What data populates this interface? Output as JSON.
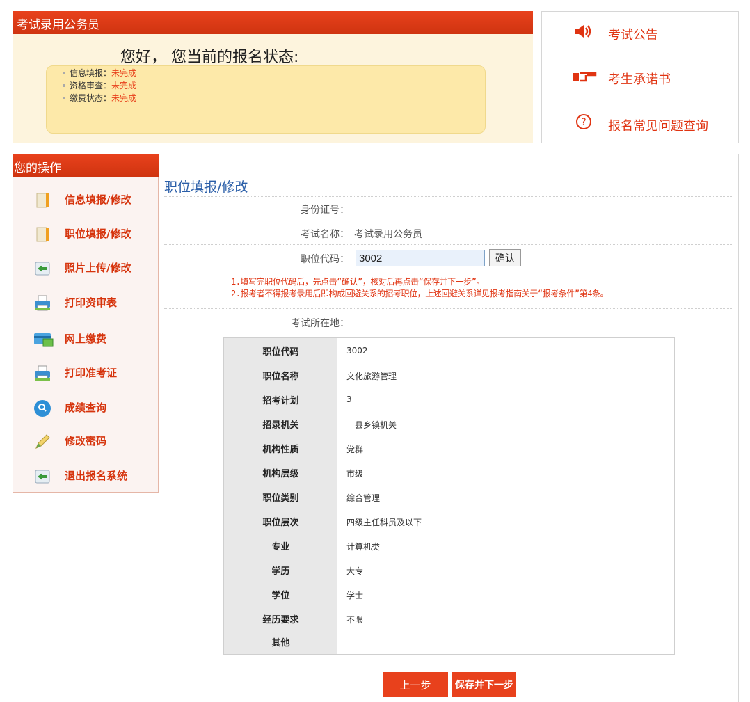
{
  "status": {
    "title": "考试录用公务员",
    "greeting": "您好， 您当前的报名状态:",
    "items": [
      {
        "label": "信息填报：",
        "value": "未完成"
      },
      {
        "label": "资格审查：",
        "value": "未完成"
      },
      {
        "label": "缴费状态：",
        "value": "未完成"
      }
    ]
  },
  "links": [
    {
      "label": "考试公告",
      "icon": "speaker-icon"
    },
    {
      "label": "考生承诺书",
      "icon": "pointing-hand-icon"
    },
    {
      "label": "报名常见问题查询",
      "icon": "question-icon"
    }
  ],
  "sidebar": {
    "title": "您的操作",
    "items": [
      {
        "label": "信息填报/修改",
        "icon": "book-icon"
      },
      {
        "label": "职位填报/修改",
        "icon": "book-icon"
      },
      {
        "label": "照片上传/修改",
        "icon": "exit-arrow-icon"
      },
      {
        "label": "打印资审表",
        "icon": "printer-icon"
      },
      {
        "label": "网上缴费",
        "icon": "payment-icon"
      },
      {
        "label": "打印准考证",
        "icon": "printer-icon"
      },
      {
        "label": "成绩查询",
        "icon": "magnifier-icon"
      },
      {
        "label": "修改密码",
        "icon": "pencil-icon"
      },
      {
        "label": "退出报名系统",
        "icon": "exit-arrow-icon"
      }
    ]
  },
  "main": {
    "title": "职位填报/修改",
    "id_label": "身份证号：",
    "id_value": "",
    "exam_label": "考试名称：",
    "exam_value": "考试录用公务员",
    "code_label": "职位代码：",
    "code_value": "3002",
    "confirm_label": "确认",
    "notes": [
      "1.填写完职位代码后，先点击“确认”，核对后再点击“保存并下一步”。",
      "2.报考者不得报考录用后即构成回避关系的招考职位，上述回避关系详见报考指南关于“报考条件”第4条。"
    ],
    "location_label": "考试所在地：",
    "location_value": ""
  },
  "detail": [
    {
      "key": "职位代码",
      "value": "3002"
    },
    {
      "key": "职位名称",
      "value": "文化旅游管理"
    },
    {
      "key": "招考计划",
      "value": "3"
    },
    {
      "key": "招录机关",
      "value": "　县乡镇机关"
    },
    {
      "key": "机构性质",
      "value": "党群"
    },
    {
      "key": "机构层级",
      "value": "市级"
    },
    {
      "key": "职位类别",
      "value": "综合管理"
    },
    {
      "key": "职位层次",
      "value": "四级主任科员及以下"
    },
    {
      "key": "专业",
      "value": "计算机类"
    },
    {
      "key": "学历",
      "value": "大专"
    },
    {
      "key": "学位",
      "value": "学士"
    },
    {
      "key": "经历要求",
      "value": "不限"
    },
    {
      "key": "其他",
      "value": ""
    }
  ],
  "buttons": {
    "prev": "上一步",
    "next": "保存并下一步"
  }
}
